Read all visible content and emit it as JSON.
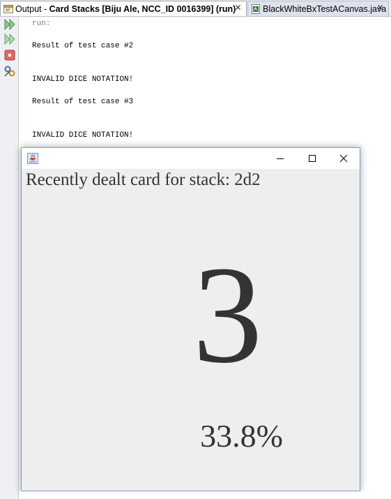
{
  "tabs": [
    {
      "prefix": "Output - ",
      "title": "Card Stacks [Biju Ale, NCC_ID 0016399] (run)",
      "icon": "output-console-icon",
      "close": "✕"
    },
    {
      "title": "BlackWhiteBxTestACanvas.java",
      "icon": "java-file-icon",
      "close": "✕"
    }
  ],
  "toolbar": {
    "buttons": [
      "rerun-icon",
      "rerun-with-options-icon",
      "stop-icon",
      "settings-icon"
    ]
  },
  "console": {
    "lines": [
      "run:",
      "Result of test case #2",
      "INVALID DICE NOTATION!",
      "Result of test case #3",
      "INVALID DICE NOTATION!"
    ]
  },
  "window": {
    "icon": "java-coffee-icon",
    "controls": {
      "minimize": "minimize-icon",
      "maximize": "maximize-icon",
      "close": "close-icon"
    },
    "heading": "Recently dealt card for stack: 2d2",
    "card_value": "3",
    "percentage": "33.8%"
  },
  "colors": {
    "window_bg": "#eeeeee",
    "window_border": "#6ea1cf",
    "text": "#333333",
    "tab_strip": "#e9ecf3"
  }
}
